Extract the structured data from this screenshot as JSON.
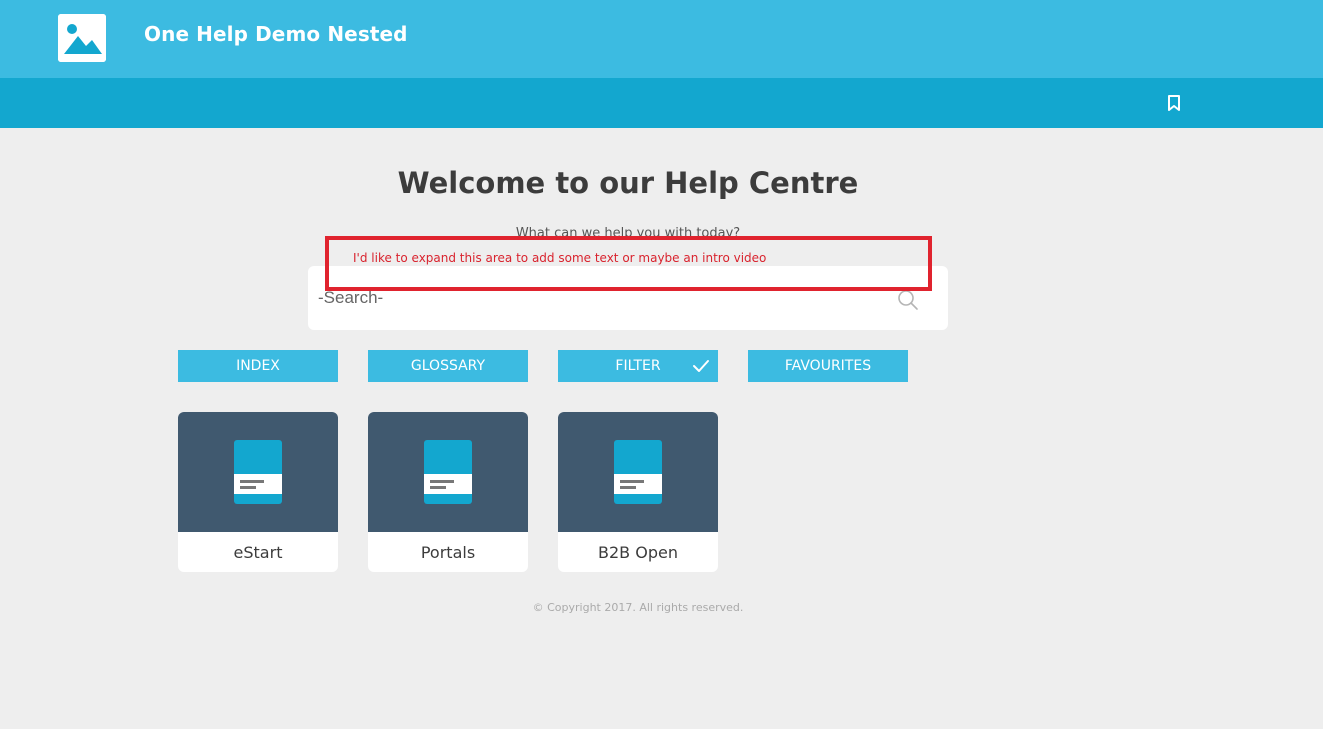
{
  "header": {
    "title": "One Help Demo Nested",
    "logo_icon": "image-placeholder-icon",
    "bookmark_icon": "bookmark-icon"
  },
  "main": {
    "heading": "Welcome to our Help Centre",
    "subtitle": "What can we help you with today?",
    "search": {
      "placeholder": "-Search-",
      "value": "",
      "icon": "search-icon"
    },
    "annotation": {
      "text": "I'd like to expand this area to add some text or maybe an intro video",
      "color": "#e0232e"
    },
    "buttons": [
      {
        "label": "INDEX"
      },
      {
        "label": "GLOSSARY"
      },
      {
        "label": "FILTER",
        "checked": true
      },
      {
        "label": "FAVOURITES"
      }
    ],
    "cards": [
      {
        "label": "eStart",
        "icon": "document-icon"
      },
      {
        "label": "Portals",
        "icon": "document-icon"
      },
      {
        "label": "B2B Open",
        "icon": "document-icon"
      }
    ]
  },
  "footer": {
    "copyright": "© Copyright 2017. All rights reserved."
  },
  "colors": {
    "topbar": "#3cbbe1",
    "navbar": "#13a7cf",
    "accent": "#3cbbe1",
    "card_thumb": "#40596f",
    "background": "#eeeeee"
  }
}
